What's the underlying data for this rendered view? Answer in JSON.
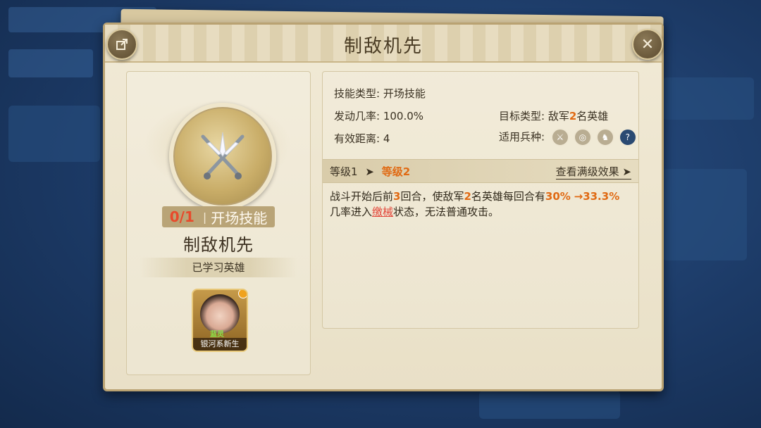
{
  "dialog": {
    "title": "制敌机先"
  },
  "left": {
    "count": "0/1",
    "separator": "|",
    "skill_category": "开场技能",
    "skill_name": "制敌机先",
    "learned_label": "已学习英雄",
    "hero": {
      "name": "银河系新生",
      "tag": "蓝灵"
    }
  },
  "details": {
    "skill_type_label": "技能类型:",
    "skill_type_value": "开场技能",
    "trigger_rate_label": "发动几率:",
    "trigger_rate_value": "100.0%",
    "target_type_label": "目标类型:",
    "target_prefix": "敌军",
    "target_count": "2",
    "target_suffix": "名英雄",
    "range_label": "有效距离:",
    "range_value": "4",
    "troop_label": "适用兵种:",
    "troop_icons": [
      "sword-icon",
      "bow-target-icon",
      "horse-icon",
      "question-icon"
    ]
  },
  "levels": {
    "level_from": "等级1",
    "arrow": "➤",
    "level_to": "等级2",
    "full_effect_link": "查看满级效果",
    "full_effect_arrow": "➤"
  },
  "description": {
    "part1": "战斗开始后前",
    "rounds": "3",
    "part2": "回合，使敌军",
    "targets": "2",
    "part3": "名英雄每回合有",
    "rate_from": "30%",
    "rate_arrow": "→",
    "rate_to": "33.3%",
    "part4": "几率进入",
    "status": "缴械",
    "part5": "状态，无法普通攻击。"
  },
  "colors": {
    "highlight": "#e06a14",
    "status_red": "#e3473a",
    "count_red": "#e84a2c"
  }
}
